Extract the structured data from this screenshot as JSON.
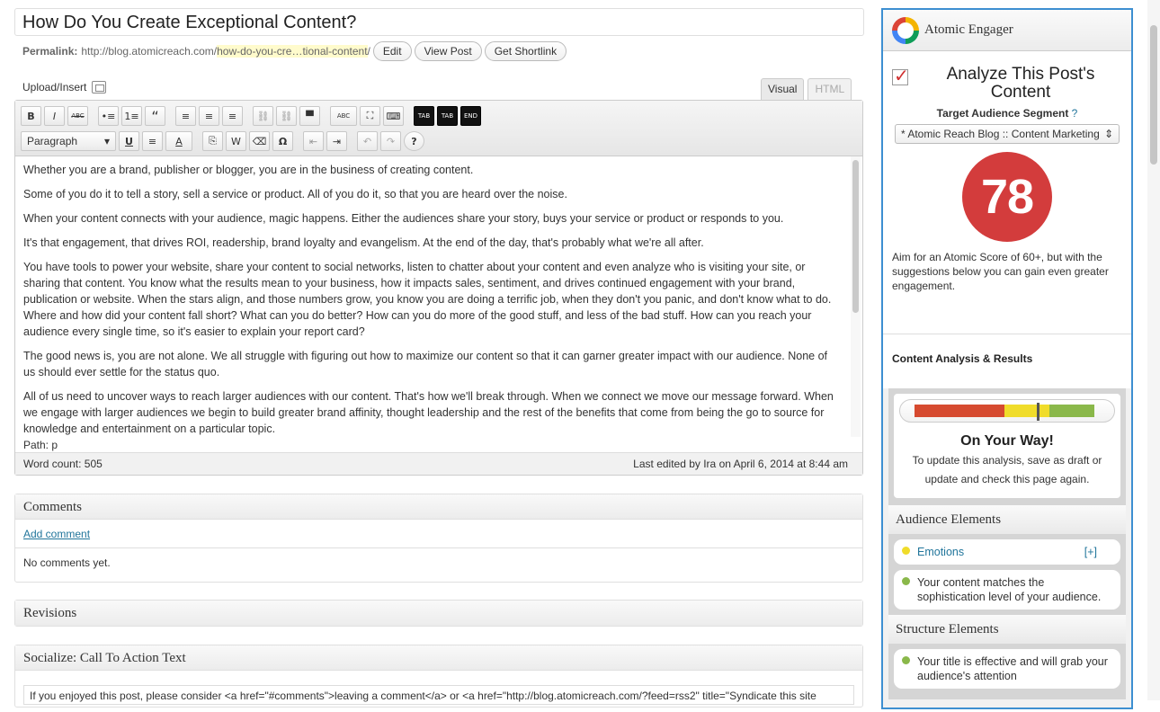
{
  "post": {
    "title": "How Do You Create Exceptional Content?",
    "permalink_label": "Permalink:",
    "permalink_base": "http://blog.atomicreach.com/",
    "permalink_slug": "how-do-you-cre…tional-content",
    "permalink_end": "/",
    "buttons": {
      "edit": "Edit",
      "view": "View Post",
      "shortlink": "Get Shortlink"
    }
  },
  "editor": {
    "upload_label": "Upload/Insert",
    "tabs": {
      "visual": "Visual",
      "html": "HTML"
    },
    "format_select": "Paragraph",
    "toolbar_row1": [
      "B",
      "I",
      "ABC",
      "•≡",
      "1≡",
      "“",
      "≡",
      "≡",
      "≡",
      "⛓",
      "⛓",
      "▀",
      "ABC",
      "⛶",
      "⌨",
      "TAB",
      "TAB",
      "END"
    ],
    "toolbar_row2": [
      "U",
      "≡",
      "A",
      "⎘",
      "W",
      "⌫",
      "Ω",
      "⇤",
      "⇥",
      "↶",
      "↷",
      "?"
    ],
    "paragraphs": [
      "Whether you are a brand, publisher or blogger, you are in the business of creating content.",
      "Some of you do it to tell a story, sell a service or product. All of you do it, so that you are heard over the noise.",
      "When your content connects with your audience, magic happens. Either the audiences share your story, buys your service or product or responds to you.",
      "It's that engagement, that drives ROI, readership, brand loyalty and evangelism. At the end of the day, that's probably what we're all after.",
      "You have tools to power your website, share your content to social networks, listen to chatter about your content and even analyze who is visiting your site, or sharing that content. You know what the results mean to your business, how it impacts sales, sentiment, and drives continued engagement with your brand, publication or website. When the stars align, and those numbers grow, you know you are doing a terrific job, when they don't you panic, and don't know what to do. Where and how did your content  fall short? What can you do better? How can you do more of the good stuff, and less of the bad stuff. How can you reach your audience every single time, so it's easier to explain your report card?",
      "The good news is,  you are not alone. We all struggle with figuring out how to maximize our content so that it can garner greater impact with our audience. None of us should ever settle for the status quo.",
      "All of us need to uncover ways to reach larger audiences with our content. That's how we'll break through. When we connect we move our message forward. When we engage with larger audiences we begin to build greater brand affinity, thought leadership and the rest of the benefits that come from being the go to source for knowledge and entertainment on a particular topic."
    ],
    "path": "Path: p",
    "word_count": "Word count: 505",
    "last_edited": "Last edited by Ira on April 6, 2014 at 8:44 am"
  },
  "comments": {
    "title": "Comments",
    "add_link": "Add comment",
    "empty": "No comments yet."
  },
  "revisions": {
    "title": "Revisions"
  },
  "socialize": {
    "title": "Socialize: Call To Action Text",
    "value": "If you enjoyed this post, please consider <a href=\"#comments\">leaving a comment</a> or <a href=\"http://blog.atomicreach.com/?feed=rss2\" title=\"Syndicate this site"
  },
  "sidebar": {
    "title": "Atomic Engager",
    "analyze_title": "Analyze This Post's Content",
    "target_label": "Target Audience Segment",
    "target_help": "?",
    "segment_value": "* Atomic Reach Blog :: Content Marketing",
    "score": "78",
    "score_color": "#d33c3c",
    "aim_text": "Aim for an Atomic Score of 60+, but with the suggestions below you can gain even greater engagement.",
    "results_title": "Content Analysis & Results",
    "meter": {
      "value": 0.68,
      "colors": [
        "#d64a2f",
        "#f0dc2a",
        "#8ab84a"
      ]
    },
    "status": "On Your Way!",
    "update_text": "To update this analysis, save as draft or update and check this page again.",
    "audience": {
      "title": "Audience Elements",
      "items": [
        {
          "label": "Emotions",
          "action": "[+]",
          "color": "#f0dc2a"
        },
        {
          "label": "Your content matches the sophistication level of your audience.",
          "color": "#8ab84a"
        }
      ]
    },
    "structure": {
      "title": "Structure Elements",
      "items": [
        {
          "label": "Your title is effective and will grab your audience's attention",
          "color": "#8ab84a"
        }
      ]
    }
  }
}
